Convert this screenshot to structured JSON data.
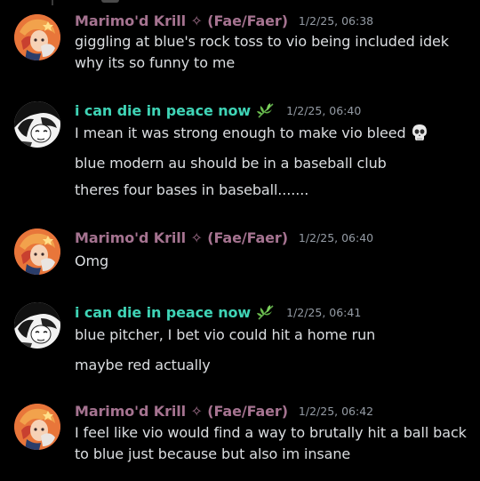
{
  "messages": [
    {
      "username": "Marimo'd Krill ✧ (Fae/Faer)",
      "timestamp": "1/2/25, 06:38",
      "lines": [
        "giggling at blue's rock toss to vio being included idek why its so funny to me"
      ],
      "avatar": "pink-orange-character-avatar"
    },
    {
      "username": "i can die in peace now",
      "timestamp": "1/2/25, 06:40",
      "lines": [
        "I mean it was strong enough to make vio bleed",
        "blue modern au should be in a baseball club",
        "theres four bases in baseball......."
      ],
      "emoji": "skull-emoji",
      "avatar": "black-white-manga-avatar"
    },
    {
      "username": "Marimo'd Krill ✧ (Fae/Faer)",
      "timestamp": "1/2/25, 06:40",
      "lines": [
        "Omg"
      ],
      "avatar": "pink-orange-character-avatar"
    },
    {
      "username": "i can die in peace now",
      "timestamp": "1/2/25, 06:41",
      "lines": [
        "blue pitcher, I bet vio could hit a home run",
        "maybe red actually"
      ],
      "avatar": "black-white-manga-avatar"
    },
    {
      "username": "Marimo'd Krill ✧ (Fae/Faer)",
      "timestamp": "1/2/25, 06:42",
      "lines": [
        "I feel like vio would find a way to brutally hit a ball back to blue just because but also im insane"
      ],
      "avatar": "pink-orange-character-avatar"
    }
  ],
  "colors": {
    "background": "#000000",
    "username_pink": "#a57390",
    "username_teal": "#3fd4b6",
    "message_text": "#dbdee1",
    "timestamp": "#949ba4"
  },
  "icons": {
    "leaf": "herb-leaf-icon",
    "skull": "skull-emoji"
  }
}
